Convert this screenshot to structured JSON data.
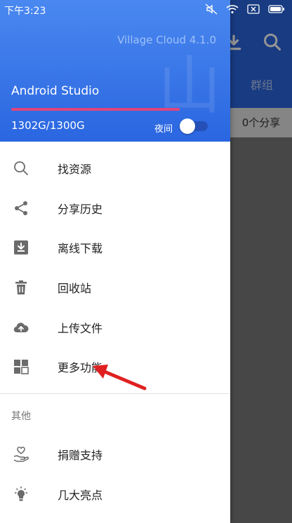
{
  "statusbar": {
    "time": "下午3:23"
  },
  "background_app": {
    "tab_label": "群组",
    "share_count": "0个分享"
  },
  "drawer": {
    "version": "Village Cloud 4.1.0",
    "watermark": "山",
    "profile_name": "Android Studio",
    "quota_text": "1302G/1300G",
    "quota_fraction": 1.0,
    "night_label": "夜间",
    "night_mode_on": false,
    "menu_items": [
      {
        "label": "找资源",
        "icon": "search-icon"
      },
      {
        "label": "分享历史",
        "icon": "share-icon"
      },
      {
        "label": "离线下载",
        "icon": "download-icon"
      },
      {
        "label": "回收站",
        "icon": "trash-icon"
      },
      {
        "label": "上传文件",
        "icon": "cloud-upload-icon"
      },
      {
        "label": "更多功能",
        "icon": "grid-icon"
      }
    ],
    "section_label": "其他",
    "other_items": [
      {
        "label": "捐赠支持",
        "icon": "donate-hand-heart-icon"
      },
      {
        "label": "几大亮点",
        "icon": "lightbulb-icon"
      }
    ]
  },
  "colors": {
    "header_blue": "#2a66e0",
    "quota_bar": "#e0457a",
    "annotation_arrow": "#e02020"
  }
}
